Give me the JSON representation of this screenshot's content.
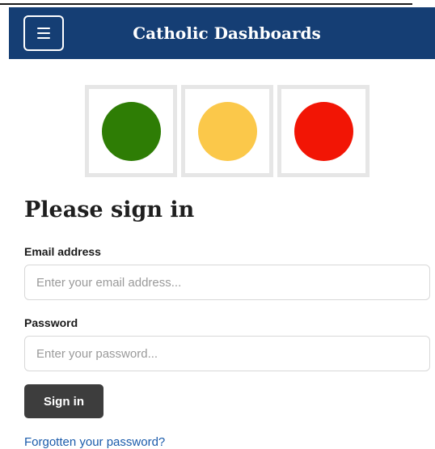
{
  "navbar": {
    "title": "Catholic Dashboards",
    "menu_icon": "hamburger-menu-icon"
  },
  "status_lights": [
    {
      "name": "green",
      "color": "#2e7d05"
    },
    {
      "name": "amber",
      "color": "#fbc84a"
    },
    {
      "name": "red",
      "color": "#f21505"
    }
  ],
  "form": {
    "heading": "Please sign in",
    "email_label": "Email address",
    "email_placeholder": "Enter your email address...",
    "password_label": "Password",
    "password_placeholder": "Enter your password...",
    "submit_label": "Sign in",
    "forgot_link": "Forgotten your password?"
  },
  "colors": {
    "navbar_bg": "#153e74",
    "button_bg": "#3d3d3d",
    "link": "#1a5bab"
  }
}
